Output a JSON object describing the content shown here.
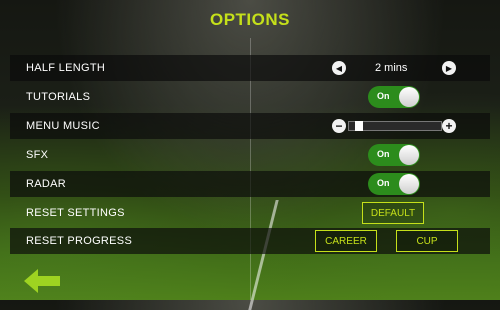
{
  "title": "OPTIONS",
  "rows": {
    "half_length": {
      "label": "HALF LENGTH",
      "value": "2 mins"
    },
    "tutorials": {
      "label": "TUTORIALS",
      "toggle": "On"
    },
    "menu_music": {
      "label": "MENU MUSIC",
      "level": 0.0
    },
    "sfx": {
      "label": "SFX",
      "toggle": "On"
    },
    "radar": {
      "label": "RADAR",
      "toggle": "On"
    },
    "reset_settings": {
      "label": "RESET SETTINGS",
      "button": "DEFAULT"
    },
    "reset_progress": {
      "label": "RESET PROGRESS",
      "button_career": "CAREER",
      "button_cup": "CUP"
    }
  },
  "colors": {
    "accent": "#c5e01a",
    "toggle_on": "#2c8c1c"
  },
  "icons": {
    "back": "back-arrow-icon",
    "prev": "left-arrow-icon",
    "next": "right-arrow-icon",
    "minus": "minus-icon",
    "plus": "plus-icon"
  }
}
